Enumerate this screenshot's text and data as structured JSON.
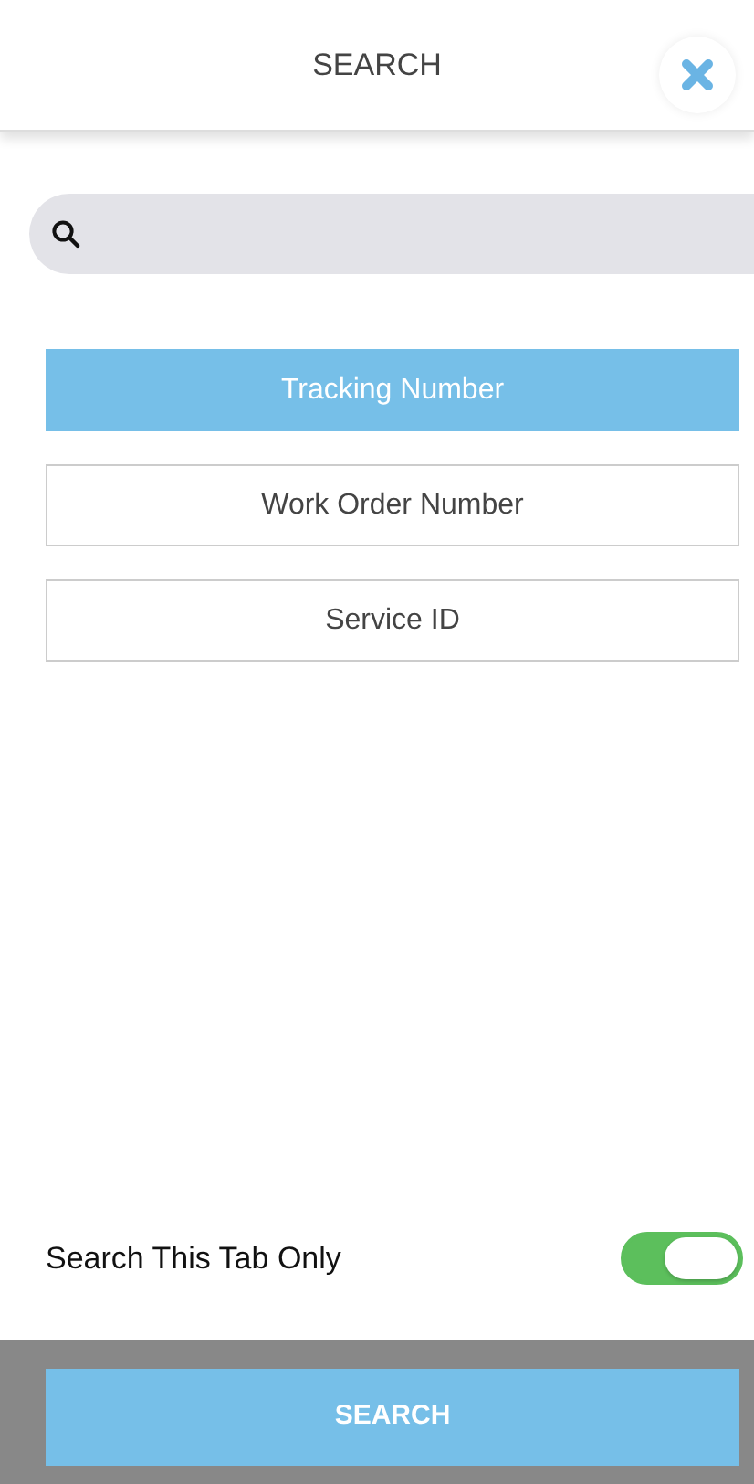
{
  "header": {
    "title": "SEARCH"
  },
  "options": [
    {
      "label": "Tracking Number",
      "selected": true
    },
    {
      "label": "Work Order Number",
      "selected": false
    },
    {
      "label": "Service ID",
      "selected": false
    }
  ],
  "toggle": {
    "label": "Search This Tab Only",
    "on": true
  },
  "submit": {
    "label": "SEARCH"
  }
}
